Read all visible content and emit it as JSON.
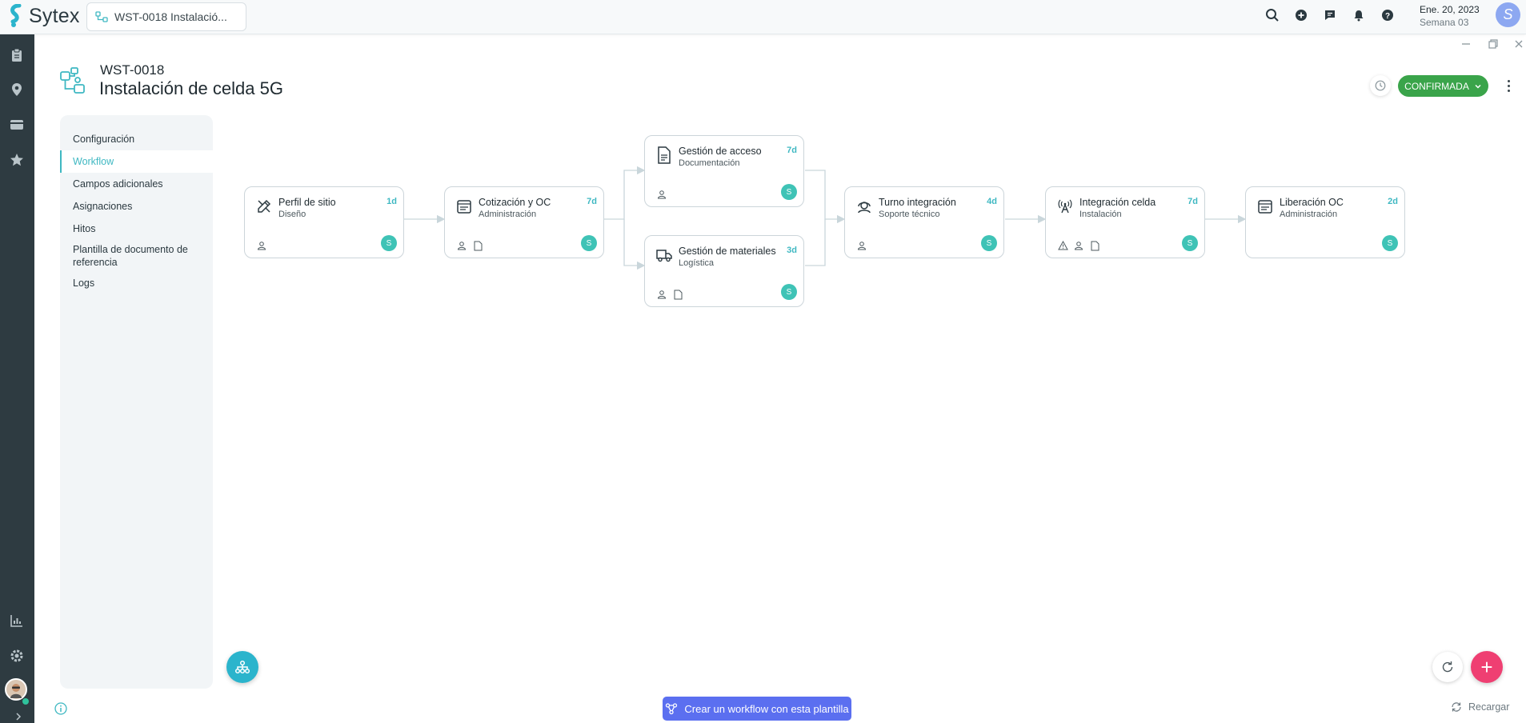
{
  "app": {
    "name": "Sytex"
  },
  "tab": {
    "label": "WST-0018 Instalació..."
  },
  "topbar": {
    "date": "Ene. 20, 2023",
    "week": "Semana 03",
    "user_initial": "S"
  },
  "header": {
    "code": "WST-0018",
    "title": "Instalación de celda 5G",
    "status_label": "CONFIRMADA",
    "status_color": "#3aa44a"
  },
  "side_menu": {
    "items": [
      {
        "label": "Configuración"
      },
      {
        "label": "Workflow"
      },
      {
        "label": "Campos adicionales"
      },
      {
        "label": "Asignaciones"
      },
      {
        "label": "Hitos"
      },
      {
        "label": "Plantilla de documento de referencia"
      },
      {
        "label": "Logs"
      }
    ],
    "active_index": 1
  },
  "workflow": {
    "nodes": [
      {
        "title": "Perfil de sitio",
        "subtitle": "Diseño",
        "duration": "1d",
        "icon": "pencil-ruler-icon",
        "footer_icons": [
          "user-icon"
        ],
        "assignee": "S"
      },
      {
        "title": "Cotización y OC",
        "subtitle": "Administración",
        "duration": "7d",
        "icon": "form-icon",
        "footer_icons": [
          "user-icon",
          "document-icon"
        ],
        "assignee": "S"
      },
      {
        "title": "Gestión de acceso",
        "subtitle": "Documentación",
        "duration": "7d",
        "icon": "document-icon",
        "footer_icons": [
          "user-icon"
        ],
        "assignee": "S"
      },
      {
        "title": "Gestión de materiales",
        "subtitle": "Logística",
        "duration": "3d",
        "icon": "truck-icon",
        "footer_icons": [
          "user-icon",
          "document-icon"
        ],
        "assignee": "S"
      },
      {
        "title": "Turno integración",
        "subtitle": "Soporte técnico",
        "duration": "4d",
        "icon": "headset-icon",
        "footer_icons": [
          "user-icon"
        ],
        "assignee": "S"
      },
      {
        "title": "Integración celda",
        "subtitle": "Instalación",
        "duration": "7d",
        "icon": "antenna-icon",
        "footer_icons": [
          "warning-icon",
          "user-icon",
          "document-icon"
        ],
        "assignee": "S"
      },
      {
        "title": "Liberación OC",
        "subtitle": "Administración",
        "duration": "2d",
        "icon": "form-icon",
        "footer_icons": [],
        "assignee": "S"
      }
    ]
  },
  "actions": {
    "create_workflow_label": "Crear un workflow con esta plantilla",
    "reload_label": "Recargar",
    "add_label": "+"
  },
  "colors": {
    "accent": "#3fb8c2",
    "rail": "#2e3b41",
    "create_button": "#5b6ff0",
    "add_button": "#ef3f72"
  }
}
